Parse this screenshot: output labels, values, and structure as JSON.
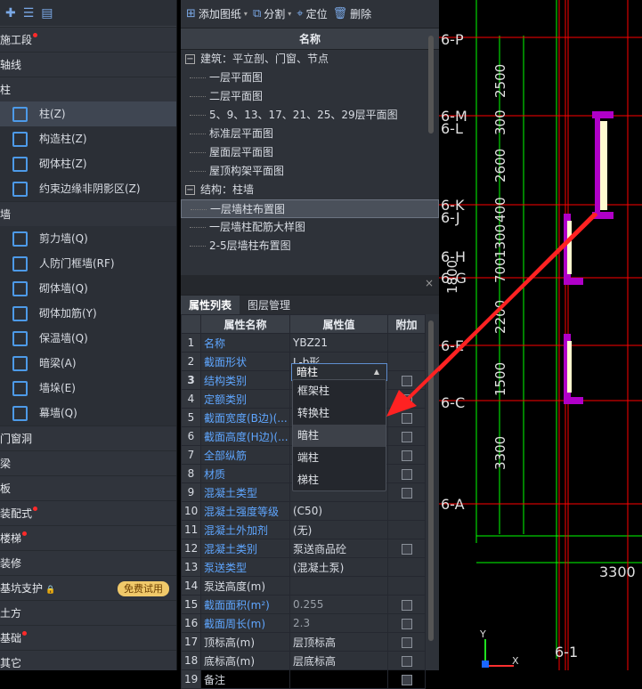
{
  "left_panel": {
    "toolbar_icons": [
      "plus-icon",
      "list-icon",
      "doc-icon"
    ],
    "sections": [
      {
        "label": "施工段",
        "dot": true
      },
      {
        "label": "轴线"
      },
      {
        "label": "柱",
        "items": [
          {
            "label": "柱(Z)",
            "selected": true
          },
          {
            "label": "构造柱(Z)"
          },
          {
            "label": "砌体柱(Z)"
          },
          {
            "label": "约束边缘非阴影区(Z)"
          }
        ]
      },
      {
        "label": "墙",
        "items": [
          {
            "label": "剪力墙(Q)"
          },
          {
            "label": "人防门框墙(RF)"
          },
          {
            "label": "砌体墙(Q)"
          },
          {
            "label": "砌体加筋(Y)"
          },
          {
            "label": "保温墙(Q)"
          },
          {
            "label": "暗梁(A)"
          },
          {
            "label": "墙垛(E)"
          },
          {
            "label": "幕墙(Q)"
          }
        ]
      },
      {
        "label": "门窗洞"
      },
      {
        "label": "梁"
      },
      {
        "label": "板"
      },
      {
        "label": "装配式",
        "dot": true
      },
      {
        "label": "楼梯",
        "dot": true
      },
      {
        "label": "装修"
      },
      {
        "label": "基坑支护",
        "badge": "免费试用"
      },
      {
        "label": "土方"
      },
      {
        "label": "基础",
        "dot": true
      },
      {
        "label": "其它"
      }
    ]
  },
  "toolbar": {
    "add": "添加图纸",
    "split": "分割",
    "locate": "定位",
    "delete": "删除"
  },
  "drawing_list": {
    "header": "名称",
    "groups": [
      {
        "label": "建筑：平立剖、门窗、节点",
        "children": [
          "一层平面图",
          "二层平面图",
          "5、9、13、17、21、25、29层平面图",
          "标准层平面图",
          "屋面层平面图",
          "屋顶构架平面图"
        ]
      },
      {
        "label": "结构：柱墙",
        "children": [
          "一层墙柱布置图",
          "一层墙柱配筋大样图",
          "2-5层墙柱布置图"
        ]
      }
    ],
    "selected": "一层墙柱布置图"
  },
  "props": {
    "tabs": [
      "属性列表",
      "图层管理"
    ],
    "headers": [
      "属性名称",
      "属性值",
      "附加"
    ],
    "rows": [
      [
        "1",
        "名称",
        "YBZ21",
        false
      ],
      [
        "2",
        "截面形状",
        "L-b形",
        false
      ],
      [
        "3",
        "结构类别",
        "暗柱",
        true
      ],
      [
        "4",
        "定额类别",
        "",
        true
      ],
      [
        "5",
        "截面宽度(B边)(...",
        "",
        true
      ],
      [
        "6",
        "截面高度(H边)(...",
        "",
        true
      ],
      [
        "7",
        "全部纵筋",
        "",
        true
      ],
      [
        "8",
        "材质",
        "",
        true
      ],
      [
        "9",
        "混凝土类型",
        "",
        true
      ],
      [
        "10",
        "混凝土强度等级",
        "(C50)",
        false
      ],
      [
        "11",
        "混凝土外加剂",
        "(无)",
        false
      ],
      [
        "12",
        "混凝土类别",
        "泵送商品砼",
        true
      ],
      [
        "13",
        "泵送类型",
        "(混凝土泵)",
        false
      ],
      [
        "14",
        "泵送高度(m)",
        "",
        false
      ],
      [
        "15",
        "截面面积(m²)",
        "0.255",
        true
      ],
      [
        "16",
        "截面周长(m)",
        "2.3",
        true
      ],
      [
        "17",
        "顶标高(m)",
        "层顶标高",
        true
      ],
      [
        "18",
        "底标高(m)",
        "层底标高",
        true
      ],
      [
        "19",
        "备注",
        "",
        true
      ]
    ],
    "dropdown_options": [
      "框架柱",
      "转换柱",
      "暗柱",
      "端柱",
      "梯柱"
    ],
    "dropdown_selected": "暗柱"
  },
  "cad": {
    "axis_labels": [
      "6-P",
      "6-M",
      "6-L",
      "6-K",
      "6-J",
      "6-H",
      "6-G",
      "6-F",
      "6-E",
      "6-C",
      "6-A",
      "6-1"
    ],
    "dims": [
      "2500",
      "300",
      "2600",
      "400",
      "1300",
      "700",
      "2200",
      "1500",
      "3300",
      "3300",
      "1800"
    ]
  }
}
